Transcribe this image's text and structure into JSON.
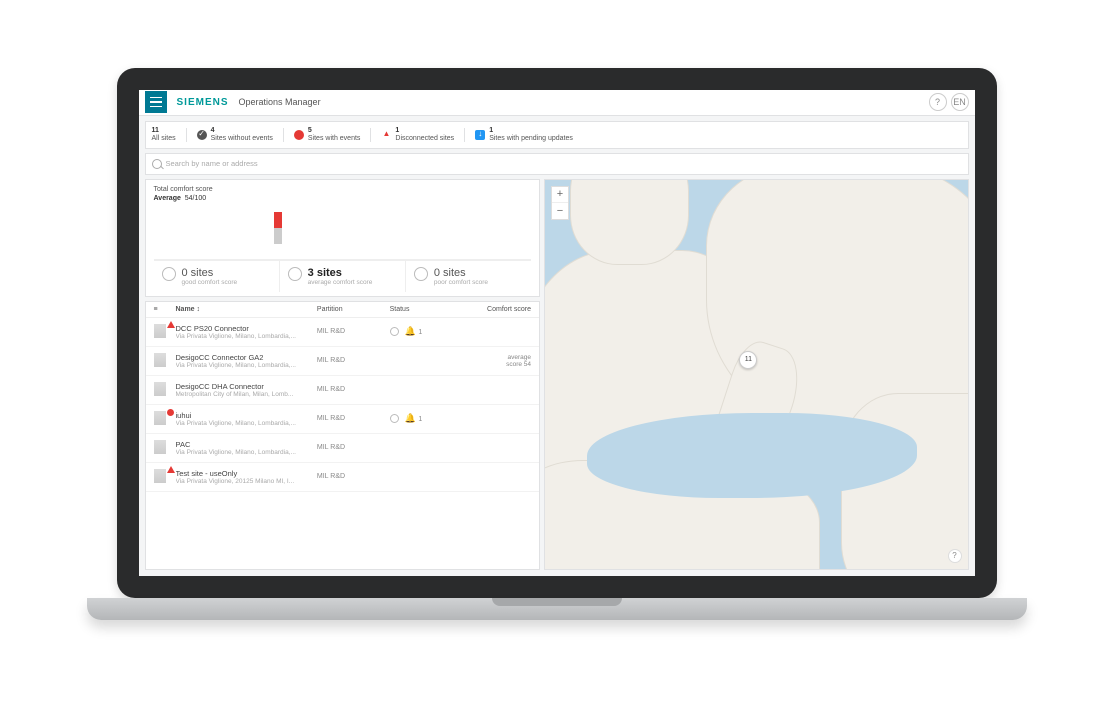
{
  "header": {
    "brand": "SIEMENS",
    "app_name": "Operations Manager",
    "help_icon": "?",
    "lang_badge": "EN"
  },
  "filters": {
    "all": {
      "count": "11",
      "label": "All sites"
    },
    "without": {
      "count": "4",
      "label": "Sites without events"
    },
    "with": {
      "count": "5",
      "label": "Sites with events"
    },
    "disconnected": {
      "count": "1",
      "label": "Disconnected sites"
    },
    "pending": {
      "count": "1",
      "label": "Sites with pending updates"
    }
  },
  "search": {
    "placeholder": "Search by name or address"
  },
  "comfort": {
    "title": "Total comfort score",
    "average_label": "Average",
    "average_value": "54/100",
    "good": {
      "big": "0 sites",
      "sub": "good comfort score"
    },
    "avg": {
      "big": "3 sites",
      "sub": "average comfort score"
    },
    "poor": {
      "big": "0 sites",
      "sub": "poor comfort score"
    }
  },
  "table": {
    "headers": {
      "name": "Name",
      "partition": "Partition",
      "status": "Status",
      "comfort": "Comfort score"
    },
    "rows": [
      {
        "name": "DCC PS20 Connector",
        "addr": "Via Privata Viglione, Milano, Lombardia,...",
        "partition": "MIL R&D",
        "has_alert": true,
        "alert": "tri",
        "has_status": true,
        "stat_count": "1",
        "comfort": ""
      },
      {
        "name": "DesigoCC Connector GA2",
        "addr": "Via Privata Viglione, Milano, Lombardia,...",
        "partition": "MIL R&D",
        "has_alert": false,
        "has_status": false,
        "comfort": "average\nscore 54"
      },
      {
        "name": "DesigoCC DHA Connector",
        "addr": "Metropolitan City of Milan, Milan, Lomb...",
        "partition": "MIL R&D",
        "has_alert": false,
        "has_status": false,
        "comfort": ""
      },
      {
        "name": "iuhui",
        "addr": "Via Privata Viglione, Milano, Lombardia,...",
        "partition": "MIL R&D",
        "has_alert": true,
        "alert": "circle",
        "has_status": true,
        "stat_count": "1",
        "comfort": ""
      },
      {
        "name": "PAC",
        "addr": "Via Privata Viglione, Milano, Lombardia,...",
        "partition": "MIL R&D",
        "has_alert": false,
        "has_status": false,
        "comfort": ""
      },
      {
        "name": "Test site - useOnly",
        "addr": "Via Privata Viglione, 20125 Milano MI, I...",
        "partition": "MIL R&D",
        "has_alert": true,
        "alert": "tri",
        "has_status": false,
        "comfort": ""
      }
    ]
  },
  "map": {
    "zoom_in": "+",
    "zoom_out": "−",
    "marker_label": "11",
    "help": "?"
  }
}
